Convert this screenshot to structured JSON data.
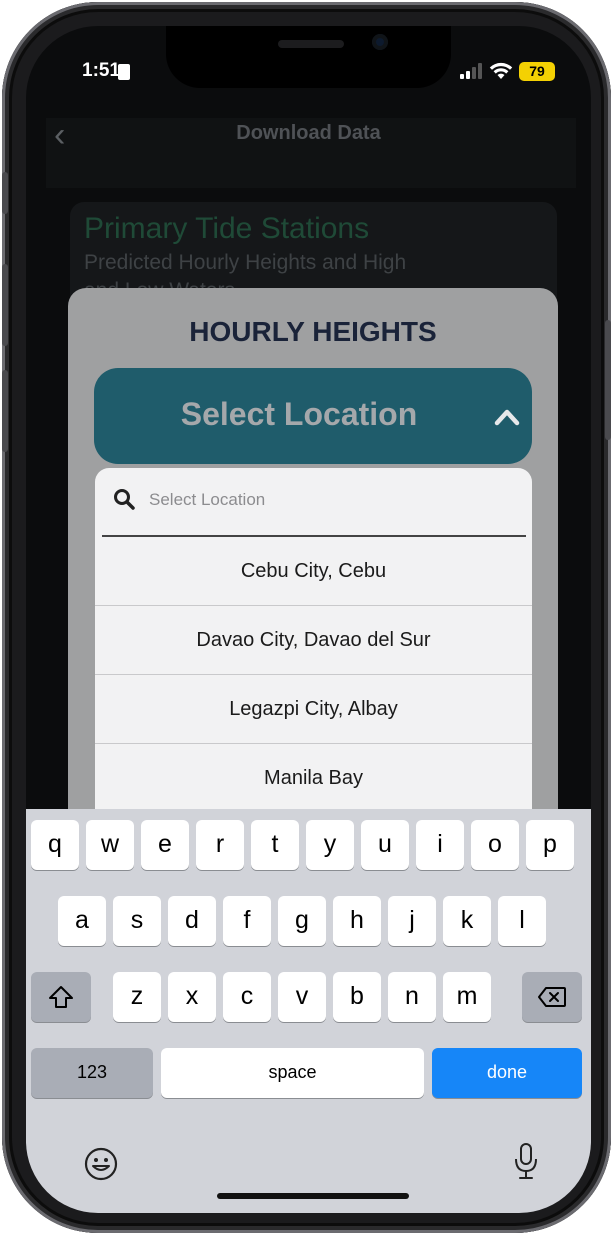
{
  "status_bar": {
    "time": "1:51",
    "battery": "79"
  },
  "nav": {
    "title": "Download Data",
    "back_icon": "chevron-left-icon"
  },
  "card": {
    "title": "Primary Tide Stations",
    "subtitle": "Predicted Hourly Heights and High and Low Waters"
  },
  "modal": {
    "title": "HOURLY HEIGHTS",
    "select_label": "Select Location"
  },
  "search": {
    "placeholder": "Select Location",
    "value": ""
  },
  "locations": [
    "Cebu City, Cebu",
    "Davao City, Davao del Sur",
    "Legazpi City, Albay",
    "Manila Bay"
  ],
  "keyboard": {
    "row1": [
      "q",
      "w",
      "e",
      "r",
      "t",
      "y",
      "u",
      "i",
      "o",
      "p"
    ],
    "row2": [
      "a",
      "s",
      "d",
      "f",
      "g",
      "h",
      "j",
      "k",
      "l"
    ],
    "row3": [
      "z",
      "x",
      "c",
      "v",
      "b",
      "n",
      "m"
    ],
    "numbers_label": "123",
    "space_label": "space",
    "done_label": "done"
  },
  "colors": {
    "accent_button": "#1f5c6b",
    "done_key": "#1686f8",
    "battery": "#f4d103"
  }
}
